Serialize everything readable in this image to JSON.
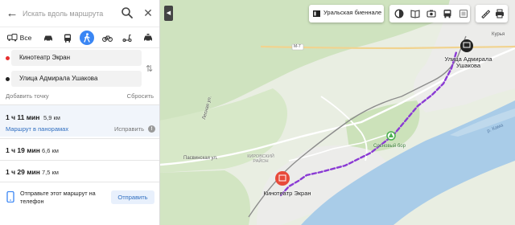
{
  "search": {
    "placeholder": "Искать вдоль маршрута"
  },
  "modes": {
    "all_label": "Все",
    "active": "walking"
  },
  "points": {
    "from": "Кинотеатр Экран",
    "to": "Улица Адмирала Ушакова"
  },
  "actions": {
    "add_point": "Добавить точку",
    "reset": "Сбросить"
  },
  "routes": [
    {
      "time": "1 ч 11 мин",
      "distance": "5,9 км",
      "panorama": "Маршрут в панорамах",
      "edit": "Исправить"
    },
    {
      "time": "1 ч 19 мин",
      "distance": "6,6 км"
    },
    {
      "time": "1 ч 29 мин",
      "distance": "7,5 км"
    }
  ],
  "send": {
    "text": "Отправьте этот маршрут на телефон",
    "button": "Отправить"
  },
  "toolbar": {
    "biennale": "Уральская биеннале"
  },
  "map": {
    "end_label": "Улица Адмирала Ушакова",
    "start_label": "Кинотеатр Экран",
    "street_pasvinskaya": "Пасвинская ул.",
    "street_lesnaya": "Лесная ул.",
    "park": "Сосновый бор",
    "district": "КИРОВСКИЙ РАЙОН",
    "road_m7": "М-7",
    "river": "р. Кама",
    "kurya": "Курья",
    "accent_route": "#8a3ad4",
    "accent_pin": "#e84a3a"
  }
}
